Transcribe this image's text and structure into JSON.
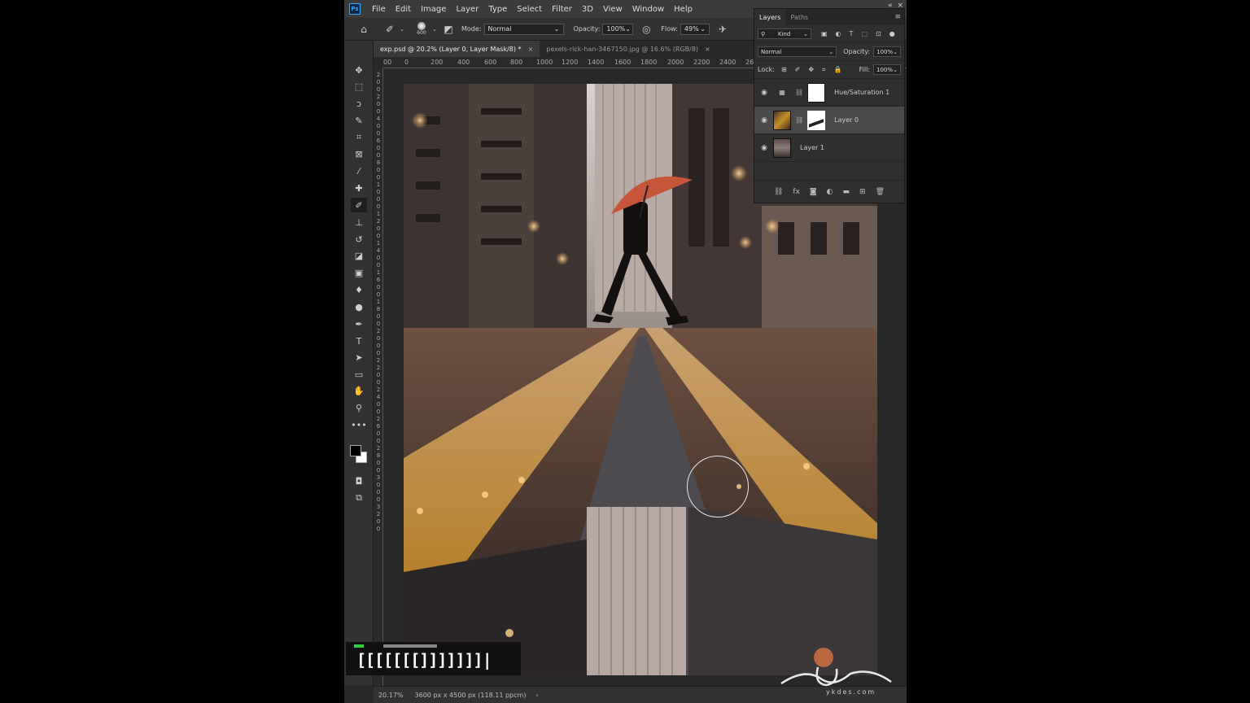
{
  "menu": {
    "logo": "Ps",
    "items": [
      "File",
      "Edit",
      "Image",
      "Layer",
      "Type",
      "Select",
      "Filter",
      "3D",
      "View",
      "Window",
      "Help"
    ],
    "controls": [
      "«",
      "×"
    ]
  },
  "options_bar": {
    "brush_size": "600",
    "mode_label": "Mode:",
    "mode_value": "Normal",
    "opacity_label": "Opacity:",
    "opacity_value": "100%",
    "flow_label": "Flow:",
    "flow_value": "49%"
  },
  "tabs": [
    {
      "label": "exp.psd @ 20.2% (Layer 0, Layer Mask/8) *",
      "active": true
    },
    {
      "label": "pexels-rick-han-3467150.jpg @ 16.6% (RGB/8)",
      "active": false
    }
  ],
  "ruler_h": [
    "00",
    "0",
    "200",
    "400",
    "600",
    "800",
    "1000",
    "1200",
    "1400",
    "1600",
    "1800",
    "2000",
    "2200",
    "2400",
    "26"
  ],
  "ruler_v": [
    "2",
    "0",
    "0",
    "2",
    "0",
    "0",
    "4",
    "0",
    "0",
    "6",
    "0",
    "0",
    "8",
    "0",
    "0",
    "1",
    "0",
    "0",
    "0",
    "1",
    "2",
    "0",
    "0",
    "1",
    "4",
    "0",
    "0",
    "1",
    "6",
    "0",
    "0",
    "1",
    "8",
    "0",
    "0",
    "2",
    "0",
    "0",
    "0",
    "2",
    "2",
    "0",
    "0",
    "2",
    "4",
    "0",
    "0",
    "2",
    "6",
    "0",
    "0",
    "2",
    "8",
    "0",
    "0",
    "3",
    "0",
    "0",
    "0",
    "3",
    "2",
    "0",
    "0"
  ],
  "tools": [
    {
      "name": "move-tool",
      "glyph": "✥"
    },
    {
      "name": "marquee-tool",
      "glyph": "⬚"
    },
    {
      "name": "lasso-tool",
      "glyph": "ↄ"
    },
    {
      "name": "quick-selection-tool",
      "glyph": "✎"
    },
    {
      "name": "crop-tool",
      "glyph": "⌗"
    },
    {
      "name": "frame-tool",
      "glyph": "⊠"
    },
    {
      "name": "eyedropper-tool",
      "glyph": "⁄"
    },
    {
      "name": "healing-brush-tool",
      "glyph": "✚"
    },
    {
      "name": "brush-tool",
      "glyph": "✐"
    },
    {
      "name": "clone-stamp-tool",
      "glyph": "⊥"
    },
    {
      "name": "history-brush-tool",
      "glyph": "↺"
    },
    {
      "name": "eraser-tool",
      "glyph": "◪"
    },
    {
      "name": "gradient-tool",
      "glyph": "▣"
    },
    {
      "name": "blur-tool",
      "glyph": "♦"
    },
    {
      "name": "dodge-tool",
      "glyph": "●"
    },
    {
      "name": "pen-tool",
      "glyph": "✒"
    },
    {
      "name": "type-tool",
      "glyph": "T"
    },
    {
      "name": "path-selection-tool",
      "glyph": "➤"
    },
    {
      "name": "shape-tool",
      "glyph": "▭"
    },
    {
      "name": "hand-tool",
      "glyph": "✋"
    },
    {
      "name": "zoom-tool",
      "glyph": "⚲"
    },
    {
      "name": "more-tools",
      "glyph": "•••"
    }
  ],
  "layers_panel": {
    "tabs": [
      "Layers",
      "Paths"
    ],
    "filter_label": "Kind",
    "blend_mode": "Normal",
    "opacity_label": "Opacity:",
    "opacity_value": "100%",
    "lock_label": "Lock:",
    "fill_label": "Fill:",
    "fill_value": "100%",
    "layers": [
      {
        "name": "Hue/Saturation 1",
        "selected": false
      },
      {
        "name": "Layer 0",
        "selected": true
      },
      {
        "name": "Layer 1",
        "selected": false
      }
    ],
    "footer_icons": [
      "link-icon",
      "fx-icon",
      "add-mask-icon",
      "adjustment-icon",
      "folder-icon",
      "new-layer-icon",
      "trash-icon"
    ]
  },
  "status": {
    "zoom": "20.17%",
    "doc_info": "3600 px x 4500 px (118.11 ppcm)",
    "arrow": "›"
  },
  "overlay": {
    "progress_text": "[[[[[[[]]]]]]]|",
    "watermark_url": "ykdes.com"
  }
}
